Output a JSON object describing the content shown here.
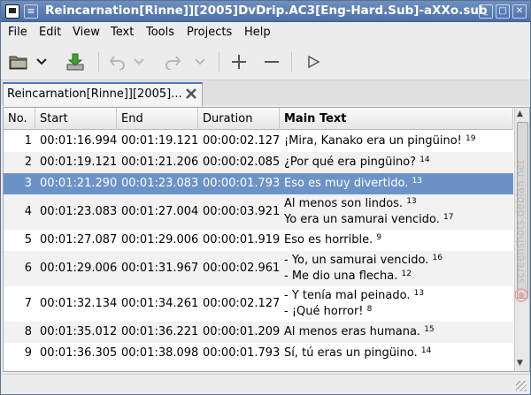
{
  "window": {
    "title": "Reincarnation[Rinne]][2005]DvDrip.AC3[Eng-Hard.Sub]-aXXo.sub"
  },
  "menubar": [
    {
      "label": "File"
    },
    {
      "label": "Edit"
    },
    {
      "label": "View"
    },
    {
      "label": "Text"
    },
    {
      "label": "Tools"
    },
    {
      "label": "Projects"
    },
    {
      "label": "Help"
    }
  ],
  "toolbar": {
    "icons": [
      "open-folder-icon",
      "dropdown-arrow-icon",
      "save-download-icon",
      "undo-icon",
      "undo-dropdown-icon",
      "redo-icon",
      "redo-dropdown-icon",
      "add-icon",
      "remove-icon",
      "play-icon"
    ]
  },
  "tab": {
    "label": "Reincarnation[Rinne]][2005]..."
  },
  "table": {
    "headers": [
      "No.",
      "Start",
      "End",
      "Duration",
      "Main Text"
    ],
    "rows": [
      {
        "no": "1",
        "start": "00:01:16.994",
        "end": "00:01:19.121",
        "duration": "00:00:02.127",
        "lines": [
          "¡Mira, Kanako era un pingüino!"
        ],
        "count": "19",
        "selected": false
      },
      {
        "no": "2",
        "start": "00:01:19.121",
        "end": "00:01:21.206",
        "duration": "00:00:02.085",
        "lines": [
          "¿Por qué era pingüino?"
        ],
        "count": "14",
        "selected": false
      },
      {
        "no": "3",
        "start": "00:01:21.290",
        "end": "00:01:23.083",
        "duration": "00:00:01.793",
        "lines": [
          "Eso es muy divertido."
        ],
        "count": "13",
        "selected": true
      },
      {
        "no": "4",
        "start": "00:01:23.083",
        "end": "00:01:27.004",
        "duration": "00:00:03.921",
        "lines": [
          "Al menos son lindos.",
          "Yo era un samurai vencido."
        ],
        "counts": [
          "13",
          "17"
        ],
        "selected": false
      },
      {
        "no": "5",
        "start": "00:01:27.087",
        "end": "00:01:29.006",
        "duration": "00:00:01.919",
        "lines": [
          "Eso es horrible."
        ],
        "count": "9",
        "selected": false
      },
      {
        "no": "6",
        "start": "00:01:29.006",
        "end": "00:01:31.967",
        "duration": "00:00:02.961",
        "lines": [
          "- Yo, un samurai vencido.",
          "- Me dio una flecha."
        ],
        "counts": [
          "16",
          "12"
        ],
        "selected": false
      },
      {
        "no": "7",
        "start": "00:01:32.134",
        "end": "00:01:34.261",
        "duration": "00:00:02.127",
        "lines": [
          "- Y tenía mal peinado.",
          "- ¡Qué horror!"
        ],
        "counts": [
          "13",
          "8"
        ],
        "selected": false
      },
      {
        "no": "8",
        "start": "00:01:35.012",
        "end": "00:01:36.221",
        "duration": "00:00:01.209",
        "lines": [
          "Al menos eras humana."
        ],
        "count": "15",
        "selected": false
      },
      {
        "no": "9",
        "start": "00:01:36.305",
        "end": "00:01:38.098",
        "duration": "00:00:01.793",
        "lines": [
          "Sí, tú eras un pingüino."
        ],
        "count": "14",
        "selected": false
      }
    ]
  },
  "watermark": {
    "text": "screenshots.debian.net"
  },
  "colors": {
    "selection": "#6b93c7",
    "titlebar": "#5a7db5",
    "accent": "#4a78c0"
  }
}
